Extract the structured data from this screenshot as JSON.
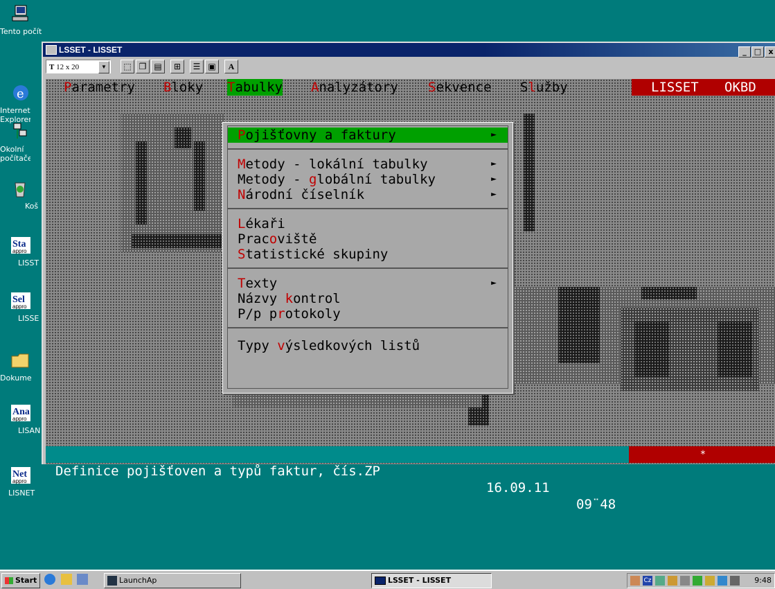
{
  "desktop": {
    "icons": [
      {
        "label": "Tento počítač",
        "icon": "computer-icon"
      },
      {
        "label": "Internet Explorer",
        "icon": "internet-explorer-icon"
      },
      {
        "label": "Okolní počítače",
        "icon": "network-icon"
      },
      {
        "label": "Koš",
        "icon": "recycle-bin-icon"
      },
      {
        "label": "LISST",
        "icon": "shortcut-icon",
        "badge": "Sta"
      },
      {
        "label": "LISSE",
        "icon": "shortcut-icon",
        "badge": "Sel"
      },
      {
        "label": "Dokume",
        "icon": "folder-icon"
      },
      {
        "label": "LISAN",
        "icon": "shortcut-icon",
        "badge": "Ana"
      },
      {
        "label": "LISNET",
        "icon": "shortcut-icon",
        "badge": "Net"
      }
    ],
    "badge_sub": "appro"
  },
  "window": {
    "title": "LSSET - LISSET",
    "controls": {
      "minimize": "_",
      "maximize": "□",
      "close": "x"
    },
    "toolbar": {
      "font_size": "12 x 20",
      "bold_a": "A"
    }
  },
  "terminal": {
    "menubar": [
      {
        "pre": "",
        "hk": "P",
        "rest": "arametry"
      },
      {
        "pre": "",
        "hk": "B",
        "rest": "loky"
      },
      {
        "pre": "",
        "hk": "T",
        "rest": "abulky",
        "selected": true
      },
      {
        "pre": "",
        "hk": "A",
        "rest": "nalyzátory"
      },
      {
        "pre": "",
        "hk": "S",
        "rest": "ekvence"
      },
      {
        "pre": "S",
        "hk": "l",
        "rest": "užby"
      }
    ],
    "right_box": {
      "left": "LISSET",
      "right": "OKBD"
    },
    "dropdown": {
      "active": {
        "pre": "",
        "hk": "P",
        "rest": "ojišťovny a faktury"
      },
      "group1": [
        {
          "pre": "",
          "hk": "M",
          "rest": "etody - lokální tabulky",
          "arrow": true
        },
        {
          "pre": "Metody - ",
          "hk": "g",
          "rest": "lobální tabulky",
          "arrow": true
        },
        {
          "pre": "",
          "hk": "N",
          "rest": "árodní číselník",
          "arrow": true
        }
      ],
      "group2": [
        {
          "pre": "",
          "hk": "L",
          "rest": "ékaři"
        },
        {
          "pre": "Prac",
          "hk": "o",
          "rest": "viště"
        },
        {
          "pre": "",
          "hk": "S",
          "rest": "tatistické skupiny"
        }
      ],
      "group3": [
        {
          "pre": "",
          "hk": "T",
          "rest": "exty",
          "arrow": true
        },
        {
          "pre": "Názvy ",
          "hk": "k",
          "rest": "ontrol"
        },
        {
          "pre": "P/p p",
          "hk": "r",
          "rest": "otokoly"
        }
      ],
      "group4": [
        {
          "pre": "Typy ",
          "hk": "v",
          "rest": "ýsledkových listů"
        }
      ],
      "arrow_glyph": "►"
    },
    "status": {
      "text": "Definice pojišťoven a typů faktur, čís.ZP",
      "date": "16.09.11",
      "time": "09¨48",
      "indicator": "*"
    }
  },
  "taskbar": {
    "start": "Start",
    "launch": "LaunchAp",
    "active_task": "LSSET - LISSET",
    "clock": "9:48"
  },
  "colors": {
    "desktop": "#007b7b",
    "menu_select": "#00a000",
    "hotkey": "#c00000",
    "red_box": "#b00000",
    "status_bar": "#008b8b"
  }
}
